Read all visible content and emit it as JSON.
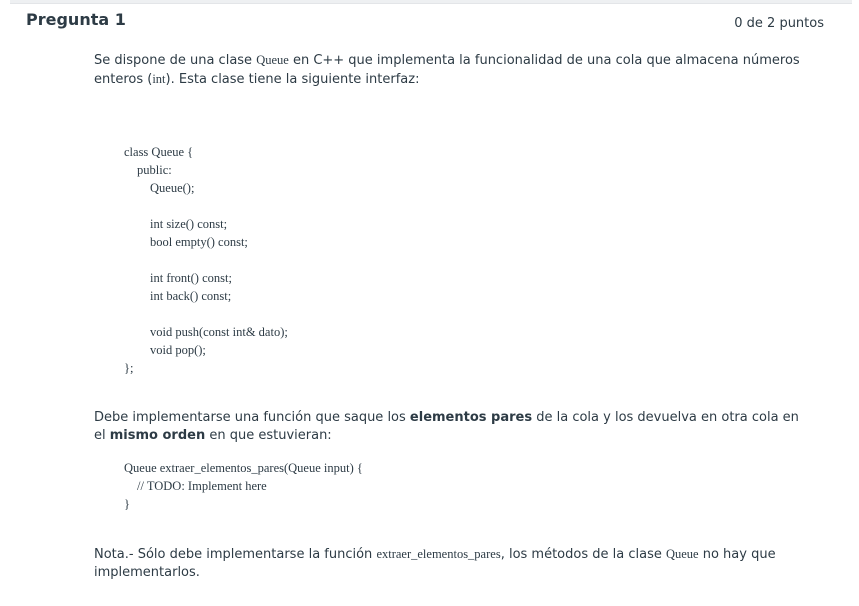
{
  "question": {
    "title": "Pregunta 1",
    "points": "0 de 2 puntos"
  },
  "intro": {
    "t1": "Se dispone de una clase ",
    "c1": "Queue",
    "t2": " en C++ que implementa la funcionalidad de una cola que almacena números enteros (",
    "c2": "int",
    "t3": "). Esta clase tiene la siguiente interfaz:"
  },
  "interface_code": {
    "l1": "class Queue {",
    "l2": "public:",
    "l3": "Queue();",
    "l4": "int size() const;",
    "l5": "bool empty() const;",
    "l6": "int front() const;",
    "l7": "int back() const;",
    "l8": "void push(const int& dato);",
    "l9": "void pop();",
    "l10": "};"
  },
  "task": {
    "t1": "Debe implementarse una función que saque los ",
    "b1": "elementos pares",
    "t2": " de la cola y los devuelva en otra cola en el ",
    "b2": "mismo orden",
    "t3": " en que estuvieran:"
  },
  "function_code": {
    "l1": "Queue extraer_elementos_pares(Queue input) {",
    "l2": "// TODO: Implement here",
    "l3": "}"
  },
  "note": {
    "t1": "Nota.- Sólo debe implementarse la función ",
    "c1": "extraer_elementos_pares",
    "t2": ", los métodos de la clase ",
    "c2": "Queue",
    "t3": " no hay que implementarlos."
  }
}
